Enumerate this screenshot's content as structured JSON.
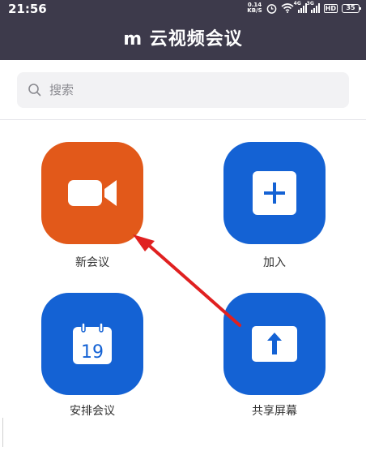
{
  "status": {
    "time": "21:56",
    "net_speed_value": "0.14",
    "net_speed_unit": "KB/S",
    "signal1_label": "4G",
    "signal2_label": "3G",
    "hd": "HD",
    "battery": "35"
  },
  "header": {
    "title": "m 云视频会议"
  },
  "search": {
    "placeholder": "搜索"
  },
  "actions": {
    "new_meeting": {
      "label": "新会议",
      "color": "#e2591a"
    },
    "join": {
      "label": "加入",
      "color": "#1462d4"
    },
    "schedule": {
      "label": "安排会议",
      "color": "#1462d4",
      "calendar_day": "19"
    },
    "share_screen": {
      "label": "共享屏幕",
      "color": "#1462d4"
    }
  },
  "annotation": {
    "color": "#e02020"
  }
}
